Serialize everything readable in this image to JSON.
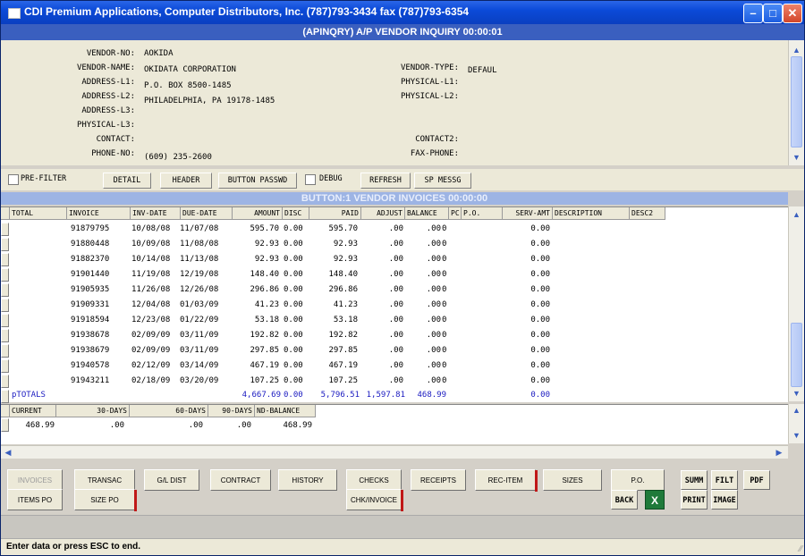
{
  "window": {
    "title": "CDI Premium Applications, Computer Distributors, Inc. (787)793-3434 fax (787)793-6354"
  },
  "subtitle": "(APINQRY) A/P VENDOR INQUIRY 00:00:01",
  "vendor": {
    "vendor_no_label": "VENDOR-NO:",
    "vendor_no": "AOKIDA",
    "vendor_name_label": "VENDOR-NAME:",
    "vendor_name": "OKIDATA CORPORATION",
    "address_l1_label": "ADDRESS-L1:",
    "address_l1": "P.O. BOX 8500-1485",
    "address_l2_label": "ADDRESS-L2:",
    "address_l2": "PHILADELPHIA, PA 19178-1485",
    "address_l3_label": "ADDRESS-L3:",
    "physical_l3_label": "PHYSICAL-L3:",
    "contact_label": "CONTACT:",
    "phone_no_label": "PHONE-NO:",
    "phone_no": "(609) 235-2600",
    "vendor_type_label": "VENDOR-TYPE:",
    "vendor_type": "DEFAUL",
    "physical_l1_label": "PHYSICAL-L1:",
    "physical_l2_label": "PHYSICAL-L2:",
    "contact2_label": "CONTACT2:",
    "fax_phone_label": "FAX-PHONE:"
  },
  "toolbar": {
    "prefilter": "PRE-FILTER",
    "detail": "DETAIL",
    "header": "HEADER",
    "button_passwd": "BUTTON PASSWD",
    "debug": "DEBUG",
    "refresh": "REFRESH",
    "sp_messg": "SP MESSG"
  },
  "band": "BUTTON:1 VENDOR INVOICES 00:00:00",
  "table": {
    "columns": [
      "TOTAL",
      "INVOICE",
      "INV-DATE",
      "DUE-DATE",
      "AMOUNT",
      "DISC",
      "PAID",
      "ADJUST",
      "BALANCE",
      "PC",
      "P.O.",
      "SERV-AMT",
      "DESCRIPTION",
      "DESC2"
    ],
    "rows": [
      {
        "invoice": "91879795",
        "inv_date": "10/08/08",
        "due_date": "11/07/08",
        "amount": "595.70",
        "disc": "0.00",
        "paid": "595.70",
        "adjust": ".00",
        "balance": ".00",
        "pc": "0",
        "serv": "0.00"
      },
      {
        "invoice": "91880448",
        "inv_date": "10/09/08",
        "due_date": "11/08/08",
        "amount": "92.93",
        "disc": "0.00",
        "paid": "92.93",
        "adjust": ".00",
        "balance": ".00",
        "pc": "0",
        "serv": "0.00"
      },
      {
        "invoice": "91882370",
        "inv_date": "10/14/08",
        "due_date": "11/13/08",
        "amount": "92.93",
        "disc": "0.00",
        "paid": "92.93",
        "adjust": ".00",
        "balance": ".00",
        "pc": "0",
        "serv": "0.00"
      },
      {
        "invoice": "91901440",
        "inv_date": "11/19/08",
        "due_date": "12/19/08",
        "amount": "148.40",
        "disc": "0.00",
        "paid": "148.40",
        "adjust": ".00",
        "balance": ".00",
        "pc": "0",
        "serv": "0.00"
      },
      {
        "invoice": "91905935",
        "inv_date": "11/26/08",
        "due_date": "12/26/08",
        "amount": "296.86",
        "disc": "0.00",
        "paid": "296.86",
        "adjust": ".00",
        "balance": ".00",
        "pc": "0",
        "serv": "0.00"
      },
      {
        "invoice": "91909331",
        "inv_date": "12/04/08",
        "due_date": "01/03/09",
        "amount": "41.23",
        "disc": "0.00",
        "paid": "41.23",
        "adjust": ".00",
        "balance": ".00",
        "pc": "0",
        "serv": "0.00"
      },
      {
        "invoice": "91918594",
        "inv_date": "12/23/08",
        "due_date": "01/22/09",
        "amount": "53.18",
        "disc": "0.00",
        "paid": "53.18",
        "adjust": ".00",
        "balance": ".00",
        "pc": "0",
        "serv": "0.00"
      },
      {
        "invoice": "91938678",
        "inv_date": "02/09/09",
        "due_date": "03/11/09",
        "amount": "192.82",
        "disc": "0.00",
        "paid": "192.82",
        "adjust": ".00",
        "balance": ".00",
        "pc": "0",
        "serv": "0.00"
      },
      {
        "invoice": "91938679",
        "inv_date": "02/09/09",
        "due_date": "03/11/09",
        "amount": "297.85",
        "disc": "0.00",
        "paid": "297.85",
        "adjust": ".00",
        "balance": ".00",
        "pc": "0",
        "serv": "0.00"
      },
      {
        "invoice": "91940578",
        "inv_date": "02/12/09",
        "due_date": "03/14/09",
        "amount": "467.19",
        "disc": "0.00",
        "paid": "467.19",
        "adjust": ".00",
        "balance": ".00",
        "pc": "0",
        "serv": "0.00"
      },
      {
        "invoice": "91943211",
        "inv_date": "02/18/09",
        "due_date": "03/20/09",
        "amount": "107.25",
        "disc": "0.00",
        "paid": "107.25",
        "adjust": ".00",
        "balance": ".00",
        "pc": "0",
        "serv": "0.00"
      }
    ],
    "totals": {
      "label": "pTOTALS",
      "amount": "4,667.69",
      "disc": "0.00",
      "paid": "5,796.51",
      "adjust": "1,597.81",
      "balance": "468.99",
      "serv": "0.00"
    }
  },
  "aging": {
    "columns": [
      "CURRENT",
      "30-DAYS",
      "60-DAYS",
      "90-DAYS",
      "ND-BALANCE"
    ],
    "values": [
      "468.99",
      ".00",
      ".00",
      ".00",
      "468.99"
    ]
  },
  "buttons_row1": [
    "INVOICES",
    "TRANSAC",
    "G/L DIST",
    "CONTRACT",
    "HISTORY",
    "CHECKS",
    "RECEIPTS",
    "REC-ITEM",
    "SIZES",
    "P.O."
  ],
  "buttons_row1_mono": [
    "SUMM",
    "FILT",
    "PDF"
  ],
  "buttons_row2": [
    "ITEMS PO",
    "SIZE PO",
    "CHK/INVOICE"
  ],
  "buttons_row2_mono": [
    "BACK",
    "PRINT",
    "IMAGE"
  ],
  "excel_icon": "X",
  "status": "Enter data or press ESC to end.",
  "colors": {
    "titlebar": "#0b4ad8",
    "subtitle": "#3a5fbf",
    "band": "#9db4e4",
    "totals": "#1a1ac0",
    "redmark": "#c01818"
  }
}
